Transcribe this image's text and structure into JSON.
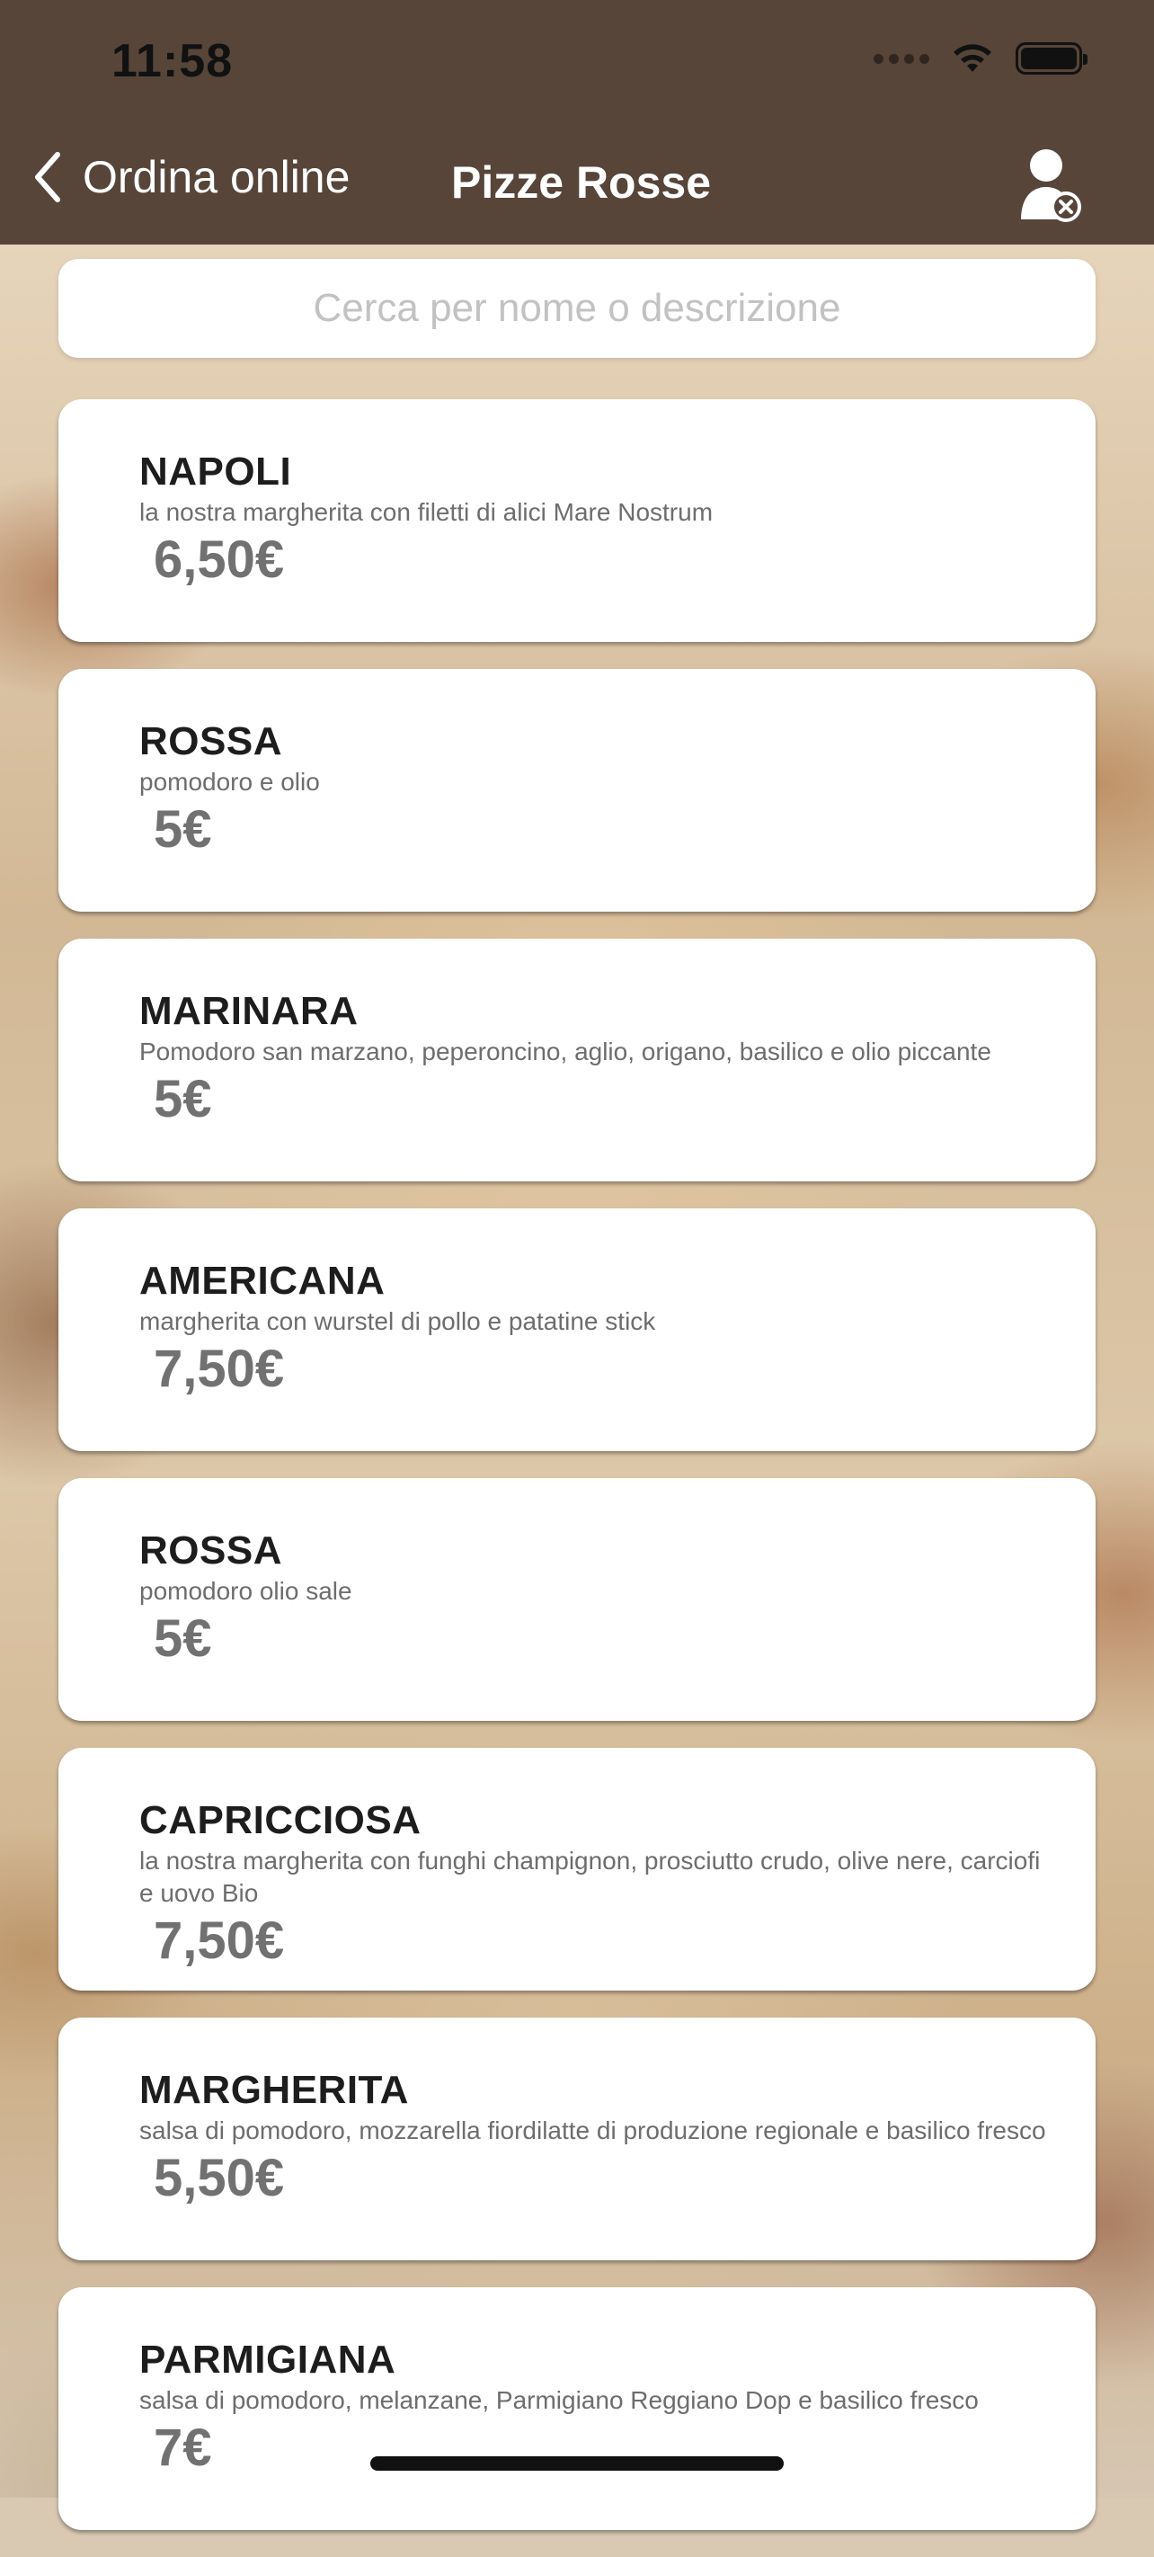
{
  "status_bar": {
    "time": "11:58",
    "signal_icon": "signal-dots-icon",
    "wifi_icon": "wifi-icon",
    "battery_icon": "battery-icon"
  },
  "nav": {
    "back_label": "Ordina online",
    "back_icon": "chevron-left-icon",
    "title": "Pizze Rosse",
    "user_icon": "user-remove-icon",
    "background_color": "#574539"
  },
  "search": {
    "placeholder": "Cerca per nome o descrizione",
    "value": ""
  },
  "items": [
    {
      "name": "NAPOLI",
      "description": "la nostra margherita con filetti di alici Mare Nostrum",
      "price": "6,50€"
    },
    {
      "name": "ROSSA",
      "description": "pomodoro e olio",
      "price": "5€"
    },
    {
      "name": "MARINARA",
      "description": "Pomodoro san marzano, peperoncino, aglio, origano, basilico e olio piccante",
      "price": "5€"
    },
    {
      "name": "AMERICANA",
      "description": "margherita con wurstel di pollo e patatine stick",
      "price": "7,50€"
    },
    {
      "name": "ROSSA",
      "description": "pomodoro olio sale",
      "price": "5€"
    },
    {
      "name": "CAPRICCIOSA",
      "description": "la nostra margherita con funghi champignon, prosciutto crudo, olive nere, carciofi e uovo Bio",
      "price": "7,50€"
    },
    {
      "name": "MARGHERITA",
      "description": "salsa di pomodoro, mozzarella fiordilatte di produzione regionale e basilico fresco",
      "price": "5,50€"
    },
    {
      "name": "PARMIGIANA",
      "description": "salsa di pomodoro, melanzane, Parmigiano Reggiano Dop e basilico fresco",
      "price": "7€"
    }
  ]
}
